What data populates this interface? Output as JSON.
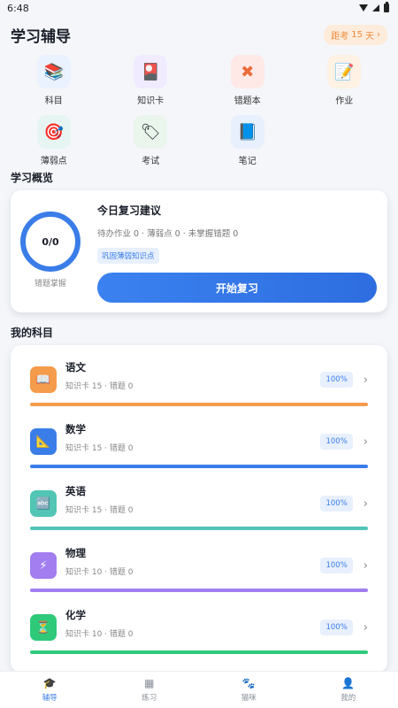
{
  "status_bar": {
    "time": "6:48"
  },
  "header": {
    "title": "学习辅导",
    "exam_prefix": "距考",
    "exam_days": "15",
    "exam_unit": "天",
    "exam_arrow": "›"
  },
  "quick_items": [
    {
      "label": "科目",
      "icon": "books-icon",
      "glyph": "📚",
      "bg": "#eaf1ff"
    },
    {
      "label": "知识卡",
      "icon": "flashcard-icon",
      "glyph": "🎴",
      "bg": "#f1ebff"
    },
    {
      "label": "错题本",
      "icon": "cross-icon",
      "glyph": "✖",
      "bg": "#ffe9e6",
      "color": "#ec6b3b"
    },
    {
      "label": "作业",
      "icon": "memo-icon",
      "glyph": "📝",
      "bg": "#fff1e3"
    },
    {
      "label": "薄弱点",
      "icon": "target-icon",
      "glyph": "🎯",
      "bg": "#e6f5f2"
    },
    {
      "label": "考试",
      "icon": "tag-icon",
      "glyph": "🏷",
      "bg": "#eaf6ec"
    },
    {
      "label": "笔记",
      "icon": "notebook-icon",
      "glyph": "📘",
      "bg": "#e8f0fd"
    }
  ],
  "overview": {
    "section_title": "学习概览",
    "ring_value": "0/0",
    "ring_label": "错题掌握",
    "title": "今日复习建议",
    "subtitle": "待办作业 0 · 薄弱点 0 · 未掌握错题 0",
    "tag": "巩固薄弱知识点",
    "button": "开始复习"
  },
  "subjects": {
    "section_title": "我的科目",
    "items": [
      {
        "name": "语文",
        "meta": "知识卡 15 · 错题 0",
        "percent": "100%",
        "icon": "open-book-icon",
        "glyph": "📖",
        "color": "#f59b4c"
      },
      {
        "name": "数学",
        "meta": "知识卡 15 · 错题 0",
        "percent": "100%",
        "icon": "ruler-triangle-icon",
        "glyph": "📐",
        "color": "#3a7de8"
      },
      {
        "name": "英语",
        "meta": "知识卡 15 · 错题 0",
        "percent": "100%",
        "icon": "abc-blocks-icon",
        "glyph": "🔤",
        "color": "#52c5b4"
      },
      {
        "name": "物理",
        "meta": "知识卡 10 · 错题 0",
        "percent": "100%",
        "icon": "lightning-icon",
        "glyph": "⚡",
        "color": "#a27ef0"
      },
      {
        "name": "化学",
        "meta": "知识卡 10 · 错题 0",
        "percent": "100%",
        "icon": "hourglass-icon",
        "glyph": "⏳",
        "color": "#2fc97a"
      }
    ]
  },
  "tabs": [
    {
      "label": "辅导",
      "icon": "graduation-cap-icon",
      "glyph": "🎓",
      "active": true
    },
    {
      "label": "练习",
      "icon": "bar-chart-icon",
      "glyph": "▦",
      "active": false
    },
    {
      "label": "猫咪",
      "icon": "paw-icon",
      "glyph": "🐾",
      "active": false
    },
    {
      "label": "我的",
      "icon": "person-icon",
      "glyph": "👤",
      "active": false
    }
  ]
}
